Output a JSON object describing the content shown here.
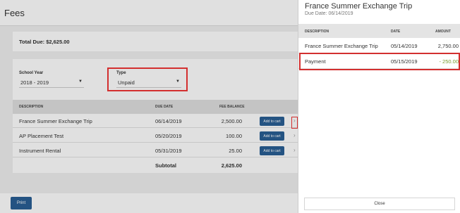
{
  "page": {
    "title": "Fees"
  },
  "summary": {
    "total_due_label": "Total Due: $2,625.00"
  },
  "filters": {
    "school_year": {
      "label": "School Year",
      "value": "2018 - 2019"
    },
    "type": {
      "label": "Type",
      "value": "Unpaid"
    }
  },
  "fees_table": {
    "headers": {
      "description": "DESCRIPTION",
      "due_date": "DUE DATE",
      "fee_balance": "FEE BALANCE"
    },
    "rows": [
      {
        "description": "France Summer Exchange Trip",
        "due_date": "06/14/2019",
        "balance": "2,500.00",
        "action": "Add to cart"
      },
      {
        "description": "AP Placement Test",
        "due_date": "05/20/2019",
        "balance": "100.00",
        "action": "Add to cart"
      },
      {
        "description": "Instrument Rental",
        "due_date": "05/31/2019",
        "balance": "25.00",
        "action": "Add to cart"
      }
    ],
    "subtotal": {
      "label": "Subtotal",
      "value": "2,625.00"
    }
  },
  "footer": {
    "print_label": "Print"
  },
  "detail_panel": {
    "title": "France Summer Exchange Trip",
    "due_date": "Due Date: 06/14/2019",
    "headers": {
      "description": "DESCRIPTION",
      "date": "DATE",
      "amount": "AMOUNT"
    },
    "rows": [
      {
        "description": "France Summer Exchange Trip",
        "date": "05/14/2019",
        "amount": "2,750.00"
      },
      {
        "description": "Payment",
        "date": "05/15/2019",
        "amount": "- 250.00"
      }
    ],
    "close_label": "Close"
  },
  "colors": {
    "accent": "#2a5f94",
    "highlight": "#d32f2f",
    "negative": "#7a9c2e"
  }
}
